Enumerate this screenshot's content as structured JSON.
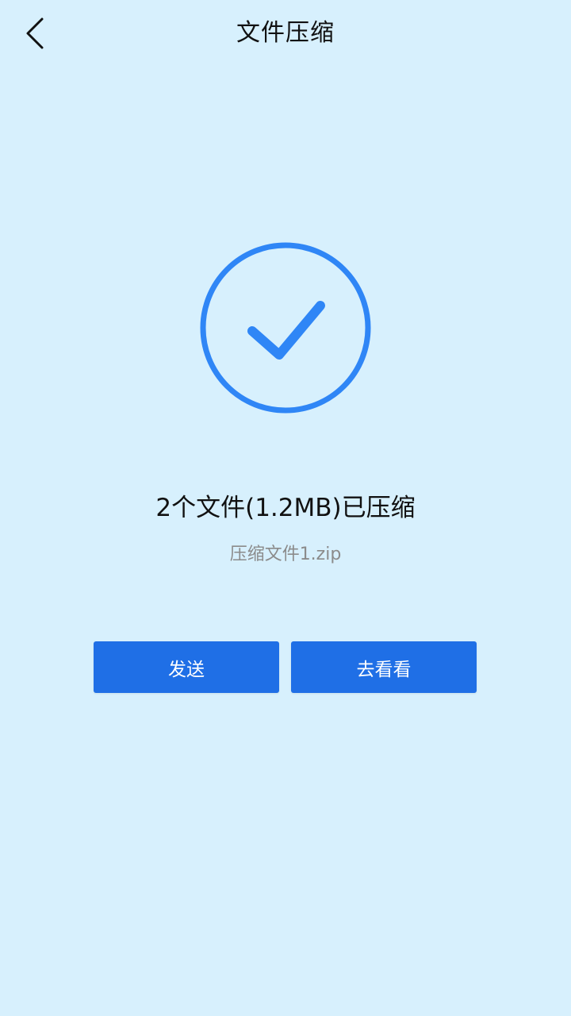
{
  "header": {
    "title": "文件压缩"
  },
  "result": {
    "summary": "2个文件(1.2MB)已压缩",
    "filename": "压缩文件1.zip"
  },
  "actions": {
    "send_label": "发送",
    "view_label": "去看看"
  },
  "colors": {
    "background": "#d7f0fd",
    "accent": "#1f6fe6",
    "icon_blue": "#2f86f6",
    "secondary_text": "#8b8b8b"
  },
  "icons": {
    "back": "chevron-left-icon",
    "success": "check-circle-icon"
  }
}
